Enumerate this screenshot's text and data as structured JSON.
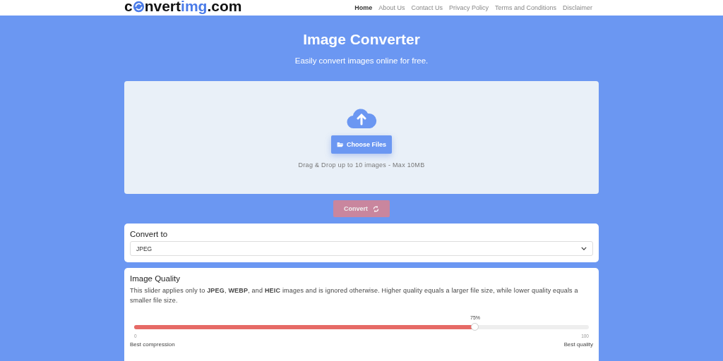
{
  "logo": {
    "lead": "c",
    "rest": "nvert",
    "accent": "img",
    "suffix": ".com"
  },
  "nav": [
    {
      "label": "Home",
      "selected": true
    },
    {
      "label": "About Us",
      "selected": false
    },
    {
      "label": "Contact Us",
      "selected": false
    },
    {
      "label": "Privacy Policy",
      "selected": false
    },
    {
      "label": "Terms and Conditions",
      "selected": false
    },
    {
      "label": "Disclaimer",
      "selected": false
    }
  ],
  "hero": {
    "title": "Image Converter",
    "subtitle": "Easily convert images online for free."
  },
  "upload": {
    "button": "Choose Files",
    "hint": "Drag & Drop up to 10 images - Max 10MB"
  },
  "convert_button": {
    "label": "Convert",
    "disabled": true
  },
  "convert_to": {
    "title": "Convert to",
    "value": "JPEG"
  },
  "quality": {
    "title": "Image Quality",
    "description": "This slider applies only to **JPEG**, **WEBP**, and **HEIC** images and is ignored otherwise. Higher quality equals a larger file size, while lower quality equals a smaller file size.",
    "reading": "75%",
    "level": 0.75,
    "min": "0",
    "max": "100",
    "min_label": "Best compression",
    "max_label": "Best quality"
  }
}
